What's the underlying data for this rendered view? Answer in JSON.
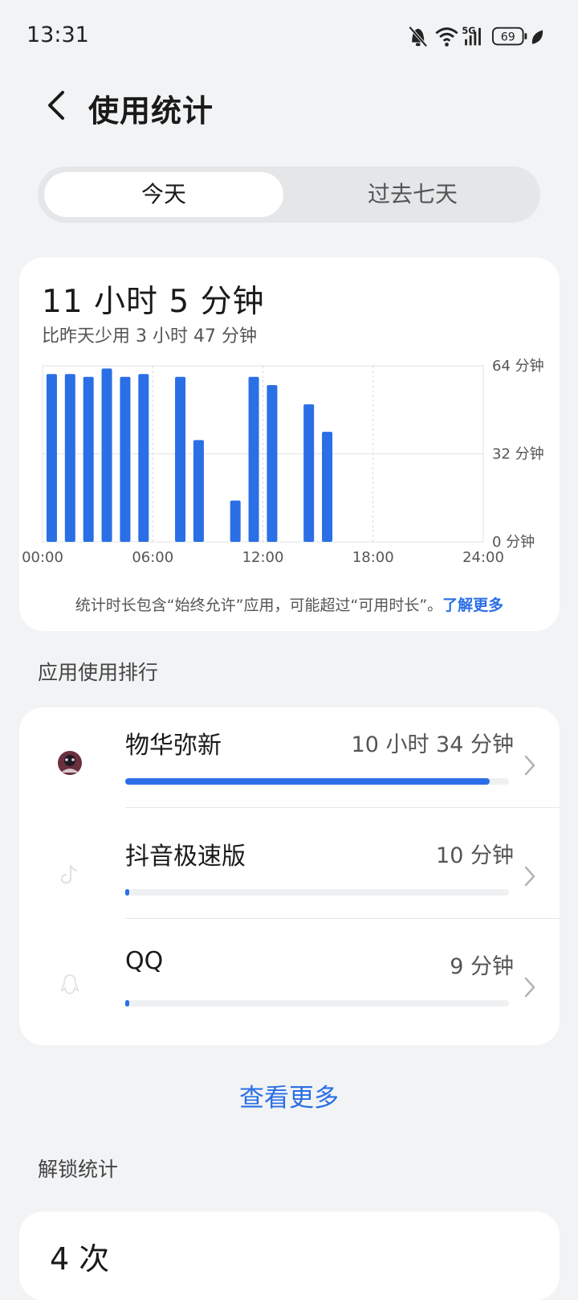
{
  "status": {
    "time": "13:31",
    "battery": "69",
    "network": "5G"
  },
  "header": {
    "title": "使用统计"
  },
  "tabs": [
    {
      "label": "今天",
      "active": true
    },
    {
      "label": "过去七天",
      "active": false
    }
  ],
  "summary": {
    "total": "11 小时 5 分钟",
    "compare": "比昨天少用 3 小时 47 分钟",
    "note": "统计时长包含“始终允许”应用，可能超过“可用时长”。",
    "note_link": "了解更多"
  },
  "chart_data": {
    "type": "bar",
    "x_tick_labels": [
      "00:00",
      "06:00",
      "12:00",
      "18:00",
      "24:00"
    ],
    "y_tick_labels": [
      "64 分钟",
      "32 分钟",
      "0 分钟"
    ],
    "ylim": [
      0,
      64
    ],
    "hours": [
      0,
      1,
      2,
      3,
      4,
      5,
      6,
      7,
      8,
      9,
      10,
      11,
      12,
      13,
      14,
      15,
      16,
      17,
      18,
      19,
      20,
      21,
      22,
      23
    ],
    "values": [
      61,
      61,
      60,
      63,
      60,
      61,
      0,
      60,
      37,
      0,
      15,
      60,
      57,
      0,
      50,
      40,
      0,
      0,
      0,
      0,
      0,
      0,
      0,
      0
    ],
    "bar_color": "#2a6fe6"
  },
  "ranking": {
    "section_label": "应用使用排行",
    "items": [
      {
        "name": "物华弥新",
        "time": "10 小时 34 分钟",
        "fraction": 0.95,
        "icon": "app-avatar-icon"
      },
      {
        "name": "抖音极速版",
        "time": "10 分钟",
        "fraction": 0.01,
        "icon": "douyin-icon"
      },
      {
        "name": "QQ",
        "time": "9 分钟",
        "fraction": 0.01,
        "icon": "qq-icon"
      }
    ],
    "more": "查看更多"
  },
  "unlock": {
    "section_label": "解锁统计",
    "count": "4 次"
  },
  "colors": {
    "accent": "#2a6fe6",
    "background": "#f1f3f5"
  }
}
